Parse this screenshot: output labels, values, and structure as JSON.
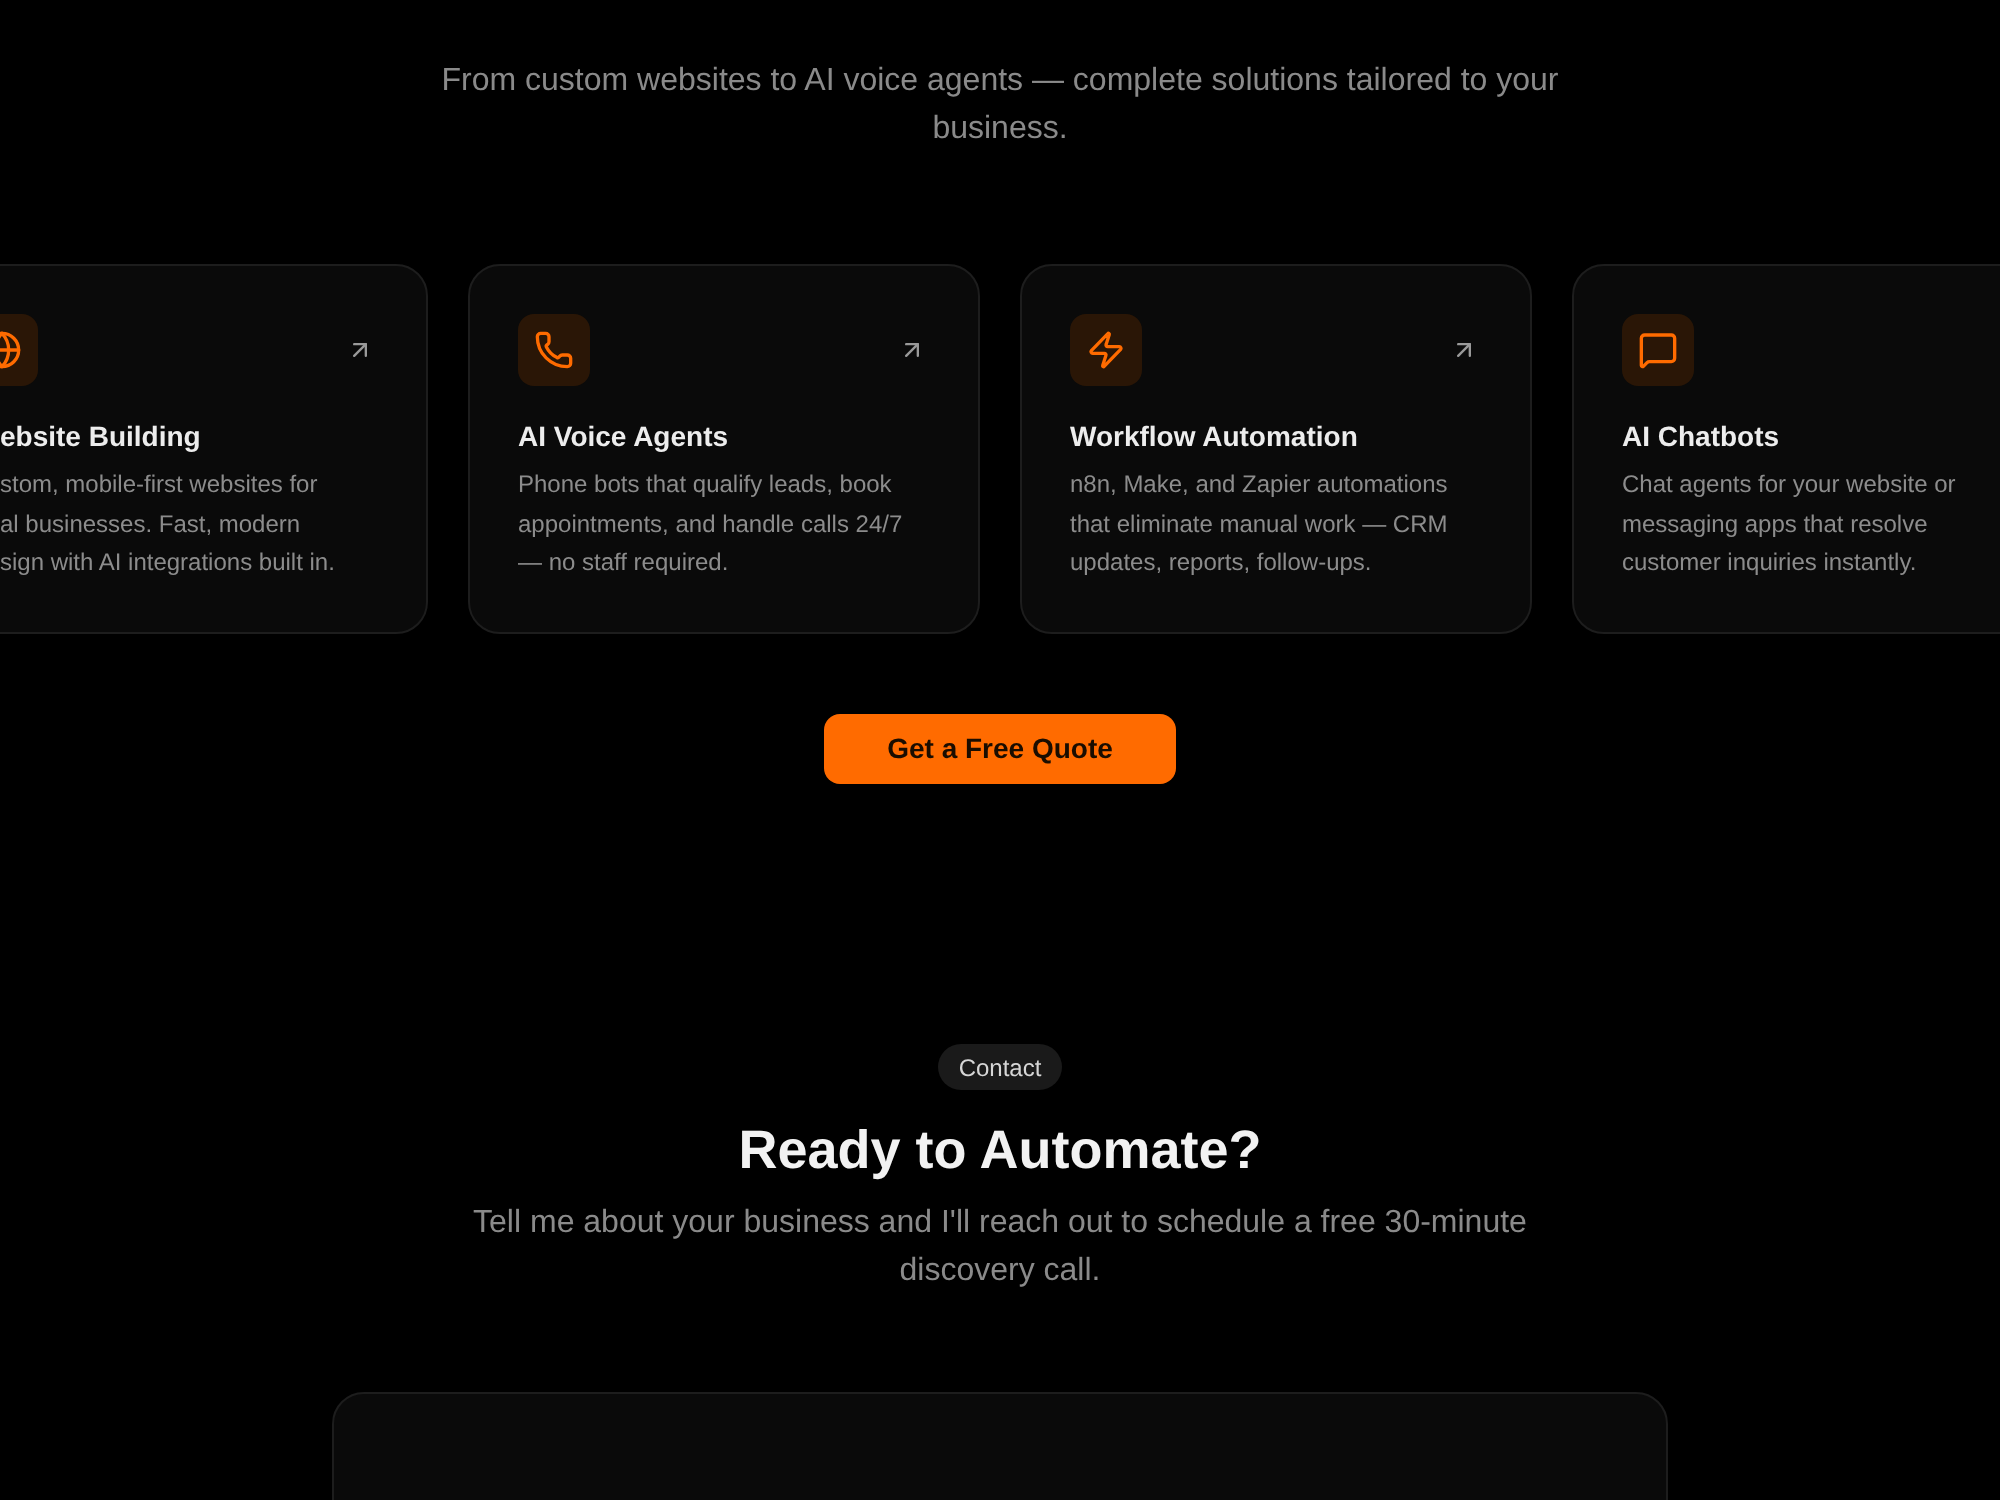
{
  "subtitle": "From custom websites to AI voice agents — complete solutions tailored to your business.",
  "services": [
    {
      "title": "ebsite Building",
      "description_lines": [
        "stom, mobile-first websites for",
        "al businesses. Fast, modern",
        "sign with AI integrations built in."
      ],
      "arrow": true,
      "cut_left": true
    },
    {
      "title": "AI Voice Agents",
      "description_lines": [
        "Phone bots that qualify leads, book",
        "appointments, and handle calls 24/7",
        "— no staff required."
      ],
      "arrow": true,
      "cut_left": false
    },
    {
      "title": "Workflow Automation",
      "description_lines": [
        "n8n, Make, and Zapier automations",
        "that eliminate manual work — CRM",
        "updates, reports, follow-ups."
      ],
      "arrow": true,
      "cut_left": false
    },
    {
      "title": "AI Chatbots",
      "description_lines": [
        "Chat agents for your website or",
        "messaging apps that resolve",
        "customer inquiries instantly."
      ],
      "arrow": false,
      "cut_left": false
    }
  ],
  "cta_button": "Get a Free Quote",
  "contact": {
    "badge": "Contact",
    "title": "Ready to Automate?",
    "subtitle": "Tell me about your business and I'll reach out to schedule a free 30-minute discovery call."
  }
}
